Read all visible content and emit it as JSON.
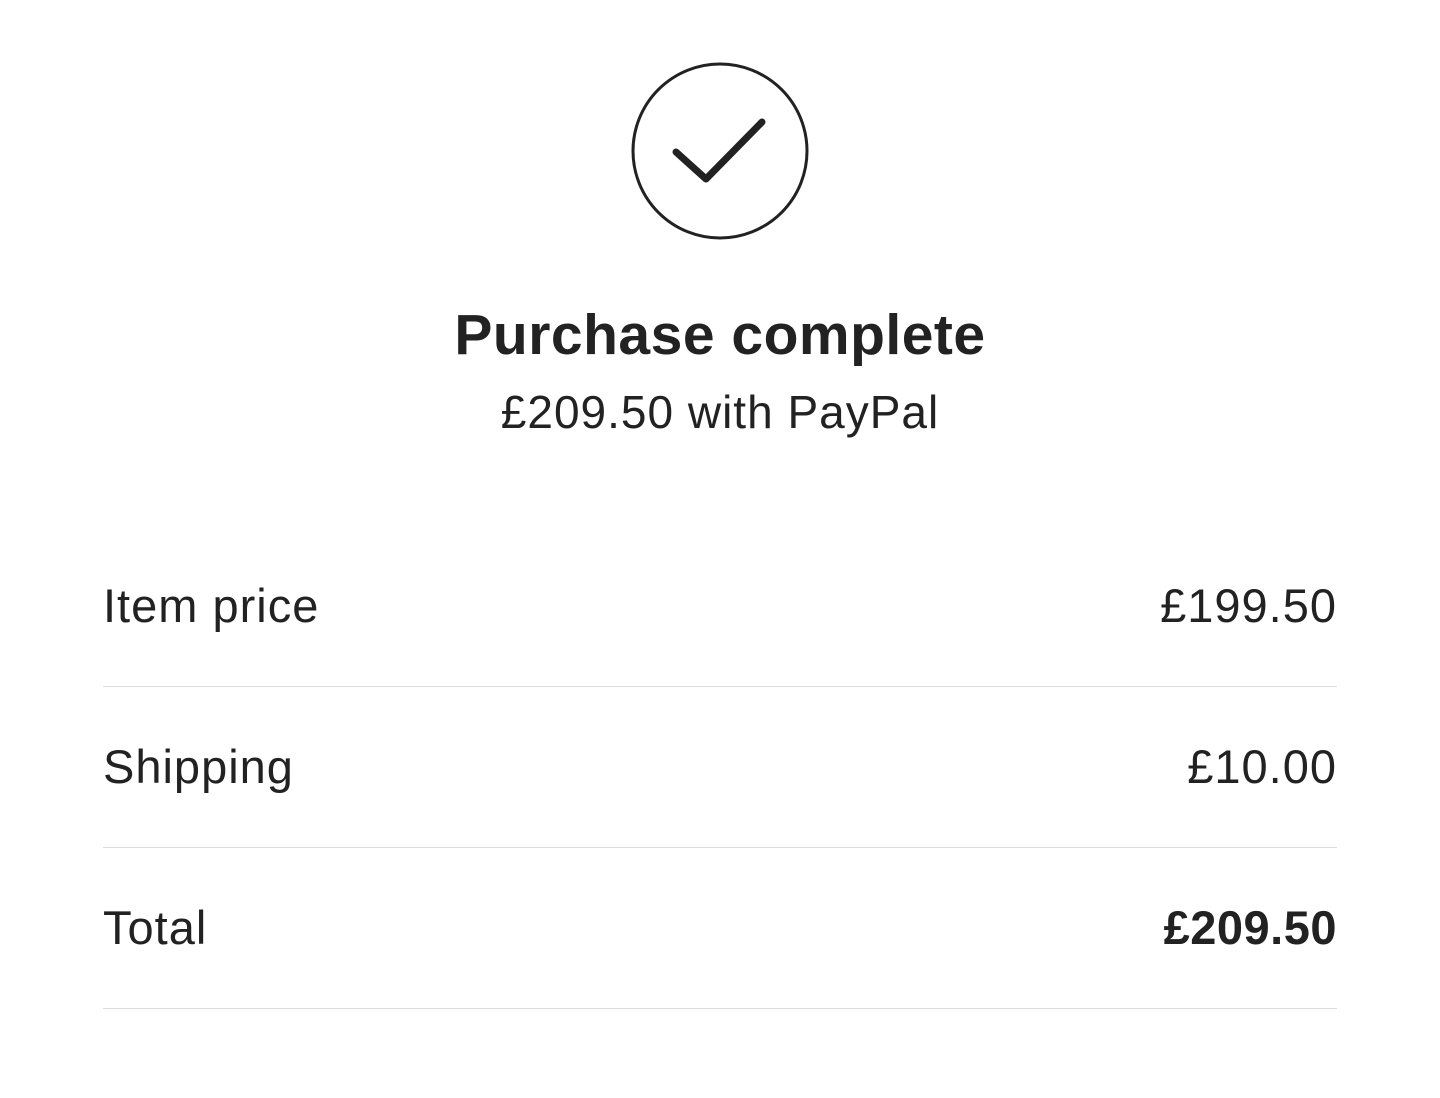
{
  "confirmation": {
    "icon": "check-circle-icon",
    "title": "Purchase complete",
    "subtitle": "£209.50 with PayPal"
  },
  "summary": {
    "rows": [
      {
        "label": "Item price",
        "value": "£199.50"
      },
      {
        "label": "Shipping",
        "value": "£10.00"
      },
      {
        "label": "Total",
        "value": "£209.50"
      }
    ]
  },
  "colors": {
    "text": "#222222",
    "divider": "#dddddd",
    "background": "#ffffff"
  }
}
